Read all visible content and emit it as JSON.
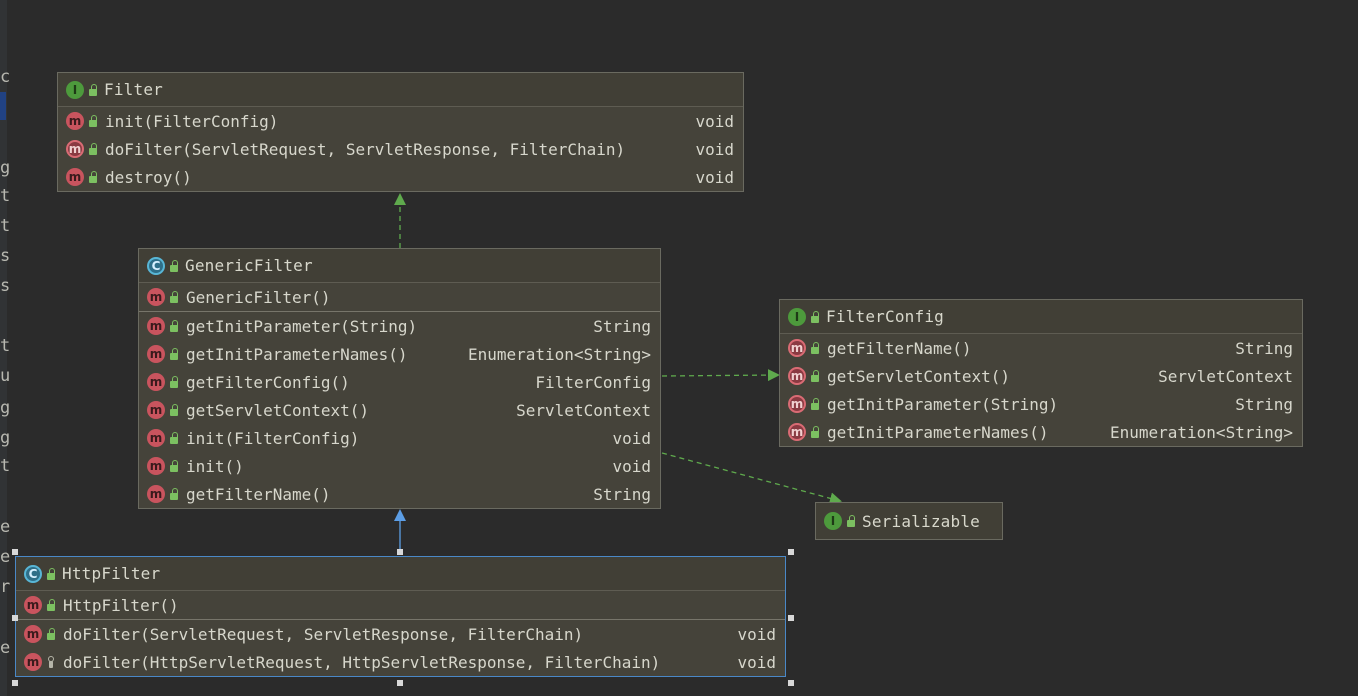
{
  "left_edge_chars": [
    "c",
    "g",
    "t",
    "t",
    "s",
    "s",
    "t",
    "u",
    "g",
    "g",
    "t",
    "e",
    "e",
    "r",
    "e"
  ],
  "colors": {
    "background": "#2b2b2b",
    "node_fill": "#45433a",
    "realization_arrow": "#5faa4d",
    "generalization_arrow": "#5c9ee6",
    "selection": "#4a88c7"
  },
  "nodes": {
    "filter": {
      "kind": "interface",
      "badge": "I",
      "title": "Filter",
      "methods": [
        {
          "badge": "m",
          "abstract": false,
          "visibility": "public",
          "name": "init(FilterConfig)",
          "type": "void"
        },
        {
          "badge": "m",
          "abstract": true,
          "visibility": "public",
          "name": "doFilter(ServletRequest, ServletResponse, FilterChain)",
          "type": "void"
        },
        {
          "badge": "m",
          "abstract": false,
          "visibility": "public",
          "name": "destroy()",
          "type": "void"
        }
      ]
    },
    "generic_filter": {
      "kind": "abstract-class",
      "badge": "C",
      "title": "GenericFilter",
      "constructors": [
        {
          "badge": "m",
          "abstract": false,
          "visibility": "public",
          "name": "GenericFilter()",
          "type": ""
        }
      ],
      "methods": [
        {
          "badge": "m",
          "abstract": false,
          "visibility": "public",
          "name": "getInitParameter(String)",
          "type": "String"
        },
        {
          "badge": "m",
          "abstract": false,
          "visibility": "public",
          "name": "getInitParameterNames()",
          "type": "Enumeration<String>"
        },
        {
          "badge": "m",
          "abstract": false,
          "visibility": "public",
          "name": "getFilterConfig()",
          "type": "FilterConfig"
        },
        {
          "badge": "m",
          "abstract": false,
          "visibility": "public",
          "name": "getServletContext()",
          "type": "ServletContext"
        },
        {
          "badge": "m",
          "abstract": false,
          "visibility": "public",
          "name": "init(FilterConfig)",
          "type": "void"
        },
        {
          "badge": "m",
          "abstract": false,
          "visibility": "public",
          "name": "init()",
          "type": "void"
        },
        {
          "badge": "m",
          "abstract": false,
          "visibility": "public",
          "name": "getFilterName()",
          "type": "String"
        }
      ]
    },
    "filter_config": {
      "kind": "interface",
      "badge": "I",
      "title": "FilterConfig",
      "methods": [
        {
          "badge": "m",
          "abstract": true,
          "visibility": "public",
          "name": "getFilterName()",
          "type": "String"
        },
        {
          "badge": "m",
          "abstract": true,
          "visibility": "public",
          "name": "getServletContext()",
          "type": "ServletContext"
        },
        {
          "badge": "m",
          "abstract": true,
          "visibility": "public",
          "name": "getInitParameter(String)",
          "type": "String"
        },
        {
          "badge": "m",
          "abstract": true,
          "visibility": "public",
          "name": "getInitParameterNames()",
          "type": "Enumeration<String>"
        }
      ]
    },
    "serializable": {
      "kind": "interface",
      "badge": "I",
      "title": "Serializable"
    },
    "http_filter": {
      "kind": "abstract-class",
      "badge": "C",
      "title": "HttpFilter",
      "selected": true,
      "constructors": [
        {
          "badge": "m",
          "abstract": false,
          "visibility": "public",
          "name": "HttpFilter()",
          "type": ""
        }
      ],
      "methods": [
        {
          "badge": "m",
          "abstract": false,
          "visibility": "public",
          "name": "doFilter(ServletRequest, ServletResponse, FilterChain)",
          "type": "void"
        },
        {
          "badge": "m",
          "abstract": false,
          "visibility": "protected",
          "name": "doFilter(HttpServletRequest, HttpServletResponse, FilterChain)",
          "type": "void"
        }
      ]
    }
  },
  "edges": [
    {
      "from": "generic_filter",
      "to": "filter",
      "kind": "realization"
    },
    {
      "from": "generic_filter",
      "to": "filter_config",
      "kind": "realization"
    },
    {
      "from": "generic_filter",
      "to": "serializable",
      "kind": "realization"
    },
    {
      "from": "http_filter",
      "to": "generic_filter",
      "kind": "generalization"
    }
  ]
}
